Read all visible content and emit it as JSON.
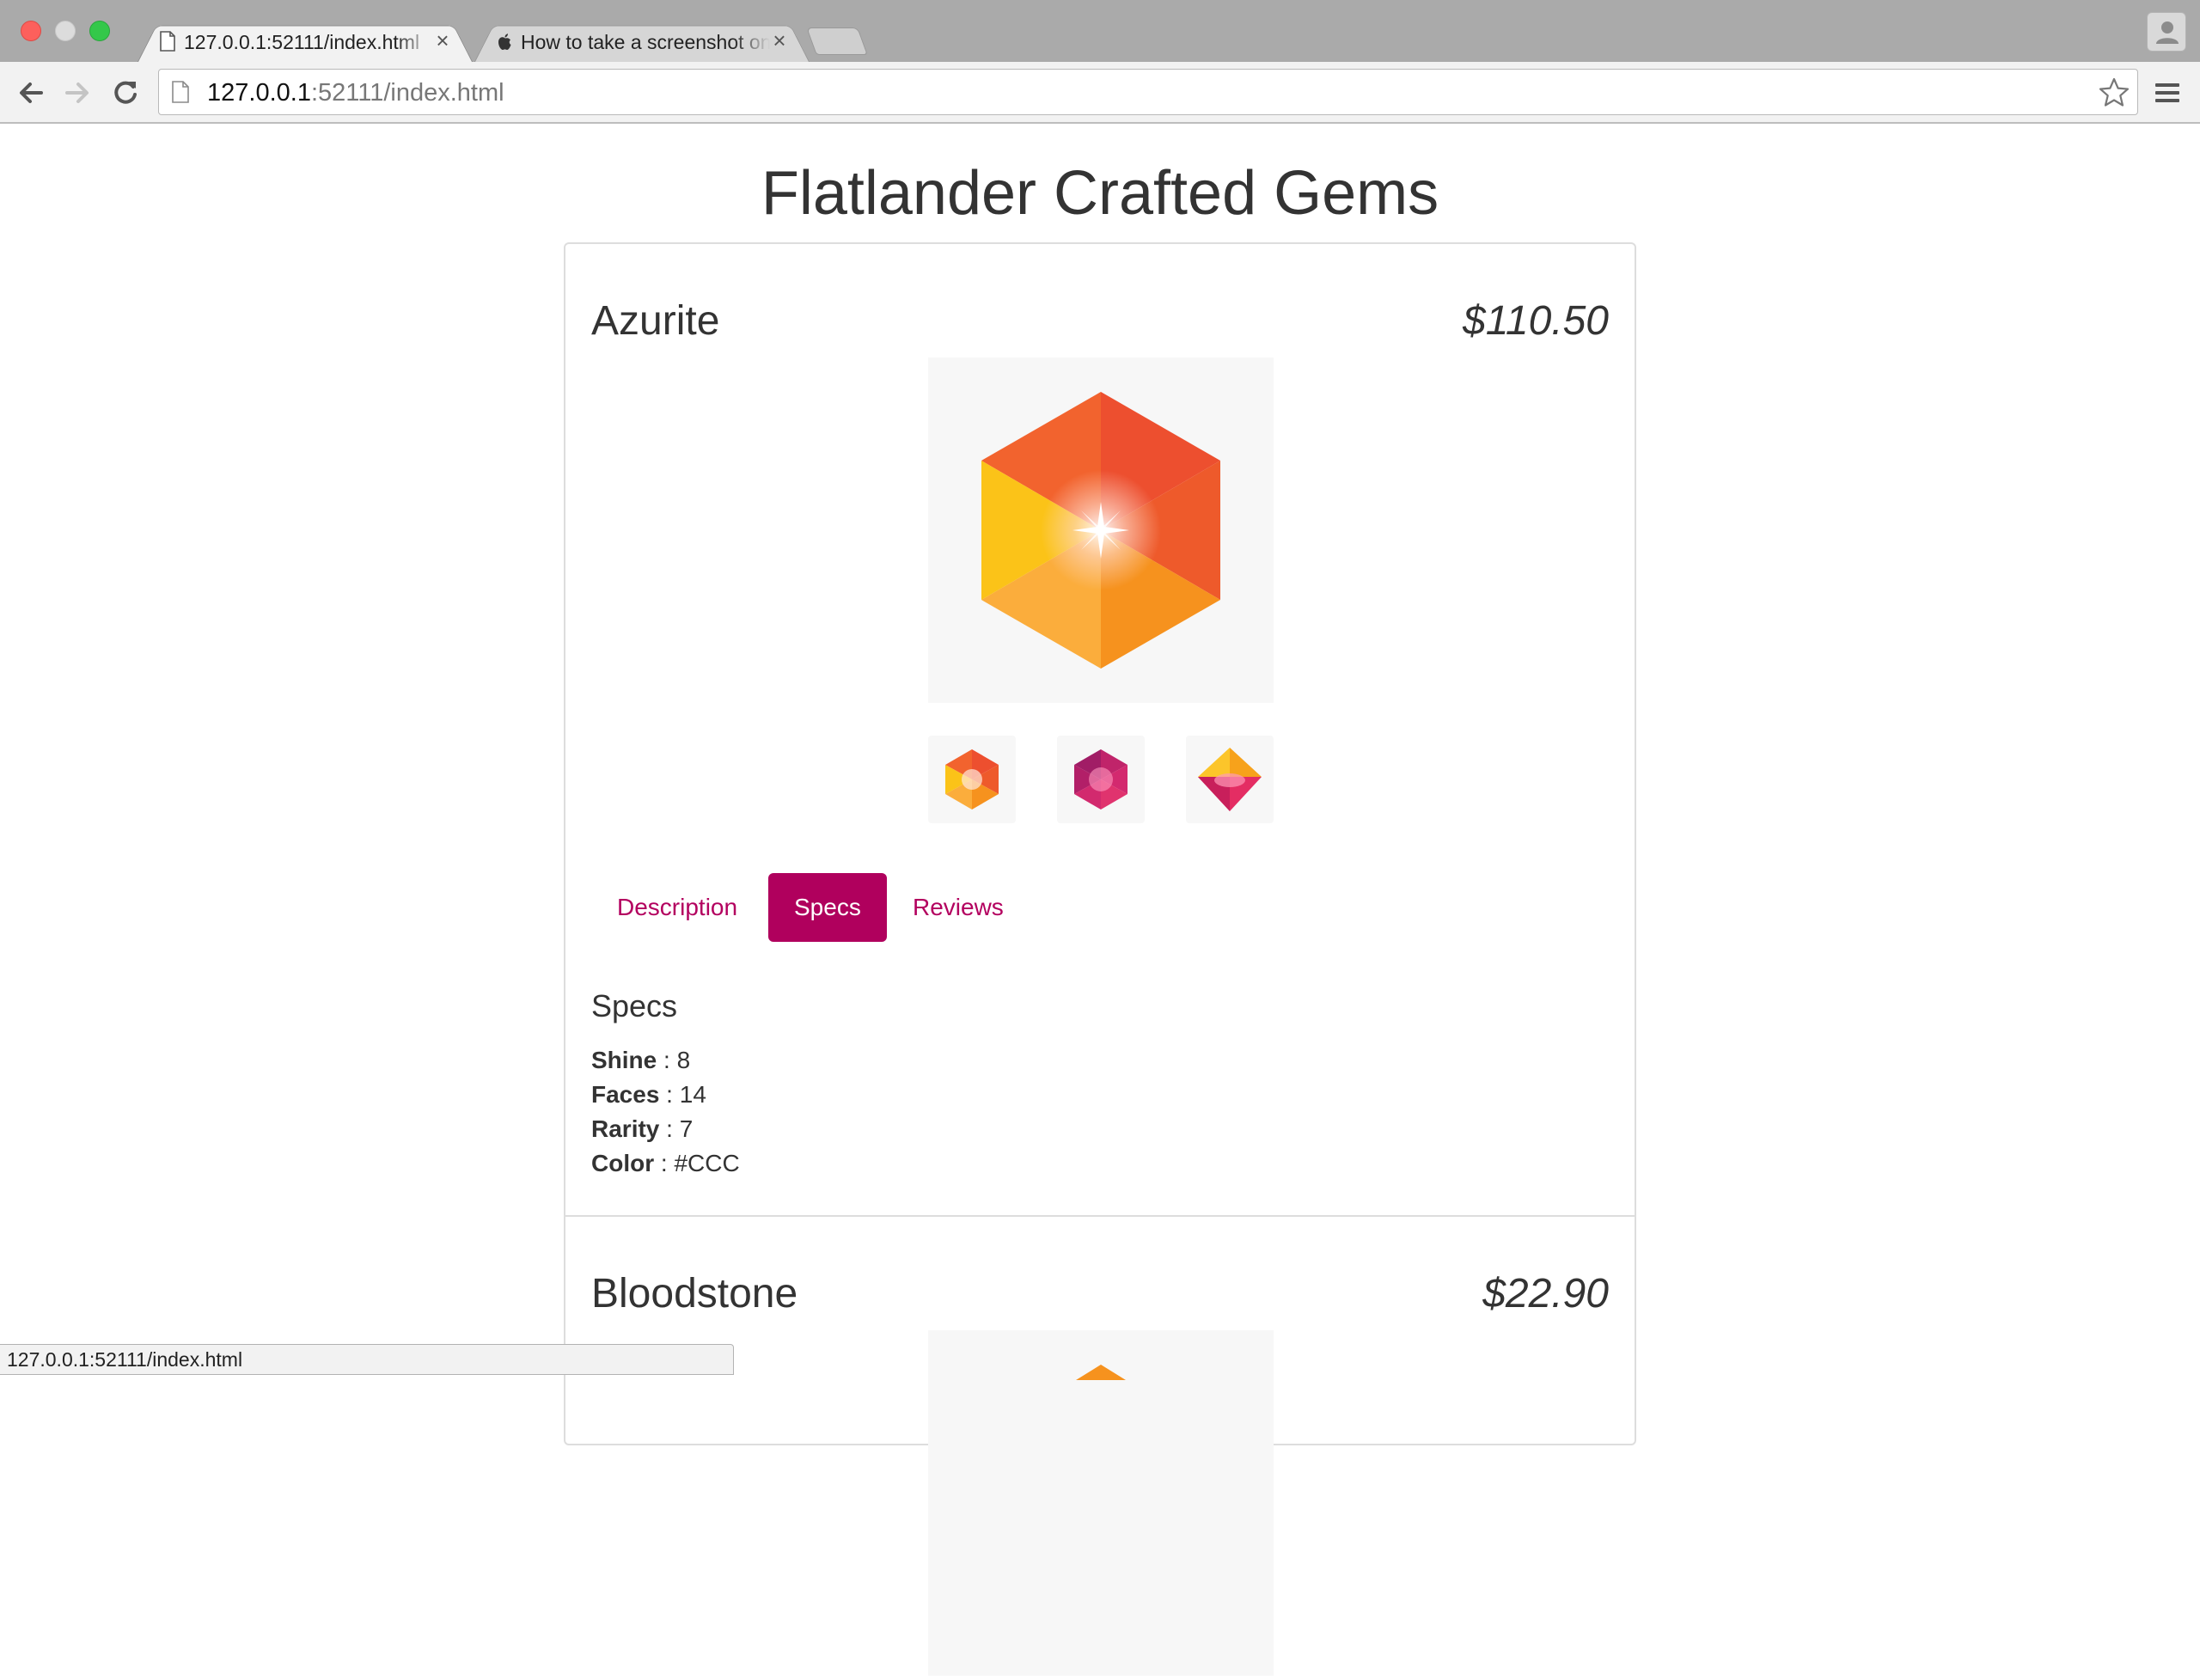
{
  "browser": {
    "tabs": [
      {
        "title": "127.0.0.1:52111/index.html",
        "active": true,
        "icon": "page-icon"
      },
      {
        "title": "How to take a screenshot on your Mac",
        "active": false,
        "icon": "apple-icon"
      }
    ],
    "address": {
      "host": "127.0.0.1",
      "rest": ":52111/index.html"
    },
    "status_url": "127.0.0.1:52111/index.html"
  },
  "page": {
    "title": "Flatlander Crafted Gems"
  },
  "products": [
    {
      "name": "Azurite",
      "price": "$110.50",
      "tabs": [
        {
          "label": "Description",
          "active": false
        },
        {
          "label": "Specs",
          "active": true
        },
        {
          "label": "Reviews",
          "active": false
        }
      ],
      "specs_heading": "Specs",
      "specs": [
        {
          "label": "Shine",
          "sep": " : ",
          "value": "8"
        },
        {
          "label": "Faces",
          "sep": " : ",
          "value": "14"
        },
        {
          "label": "Rarity",
          "sep": " : ",
          "value": "7"
        },
        {
          "label": "Color",
          "sep": " : ",
          "value": "#CCC"
        }
      ]
    },
    {
      "name": "Bloodstone",
      "price": "$22.90"
    }
  ],
  "colors": {
    "accent": "#b0005d",
    "tab_text": "#b3005f",
    "text": "#333333",
    "border": "#dddddd"
  }
}
